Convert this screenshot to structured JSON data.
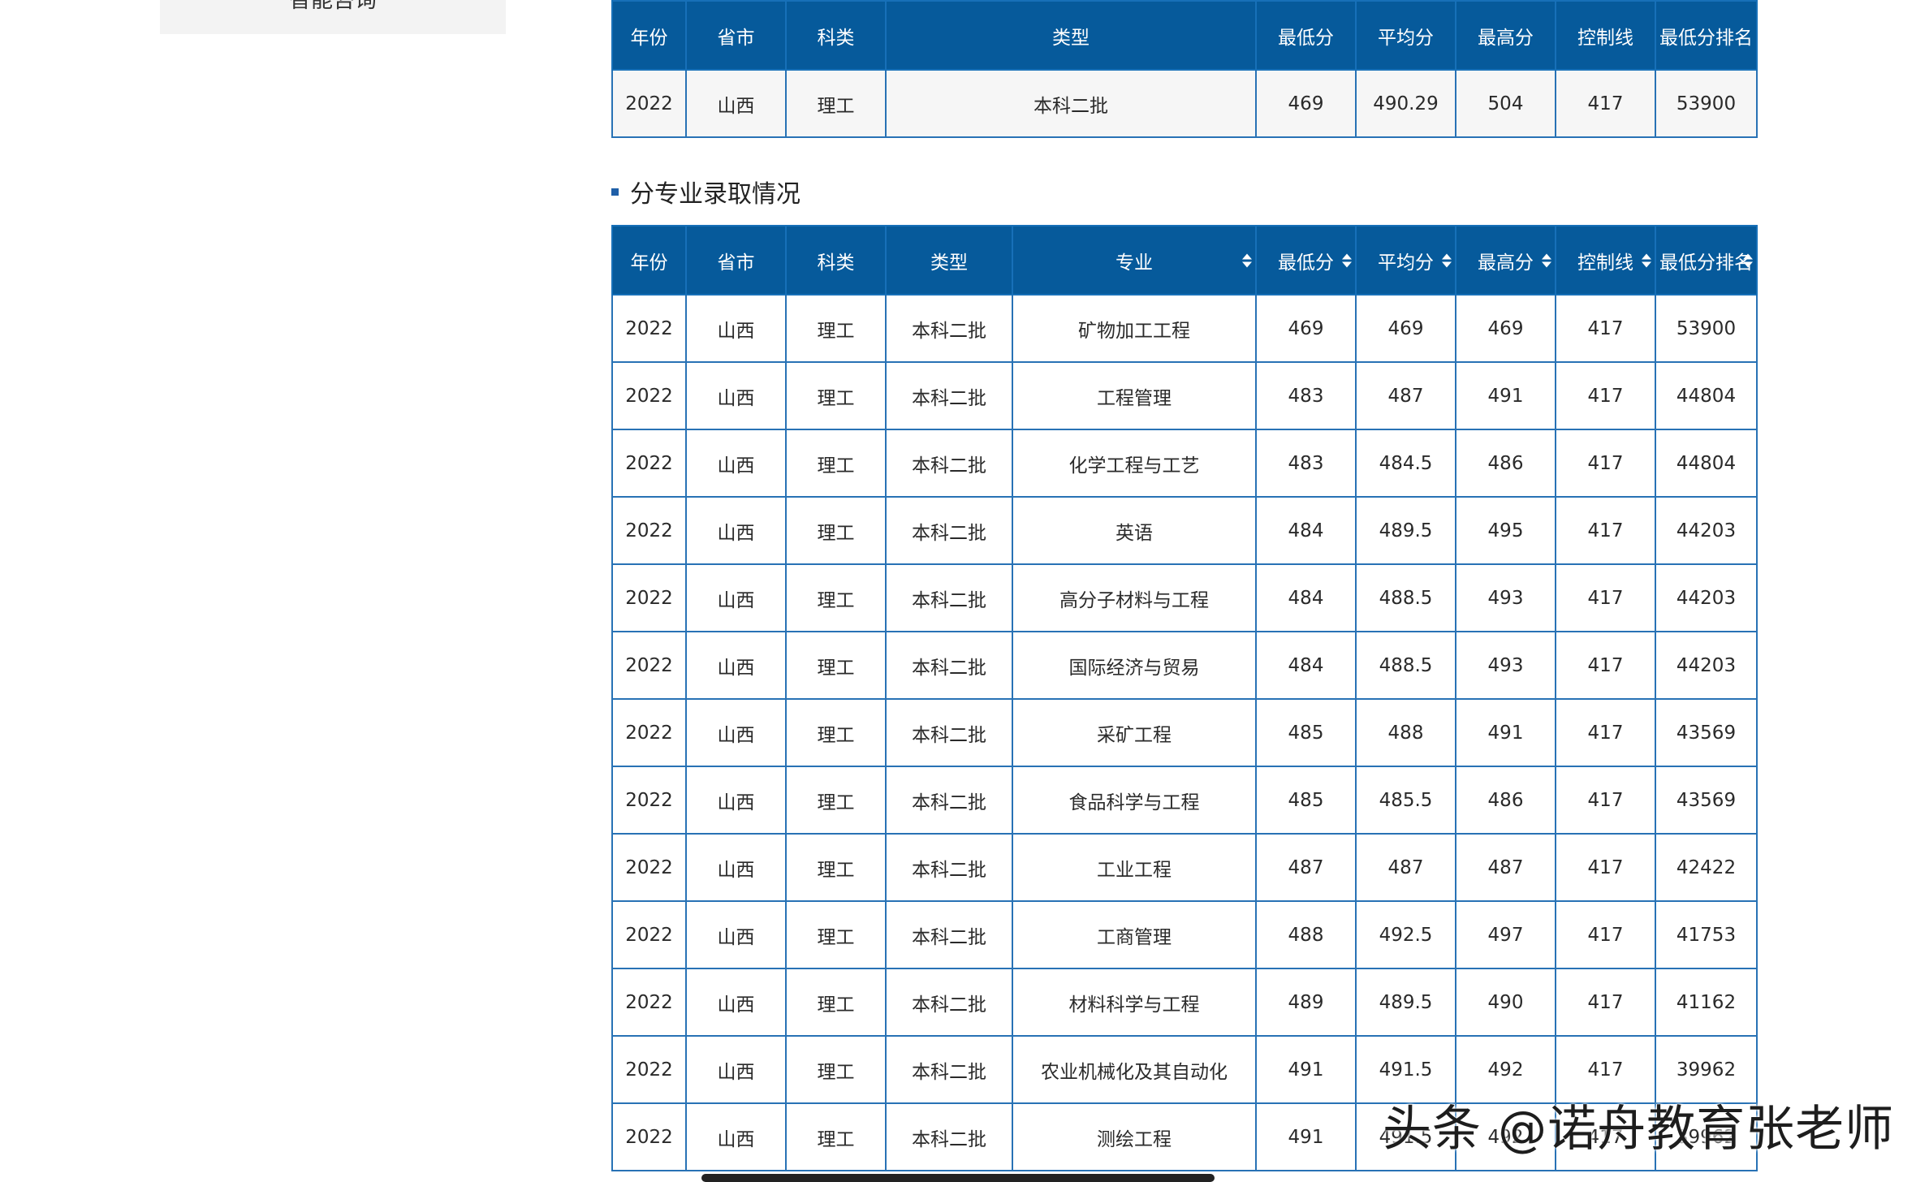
{
  "sidebar": {
    "partial_label": "智能咨询"
  },
  "summary_table": {
    "headers": [
      "年份",
      "省市",
      "科类",
      "类型",
      "最低分",
      "平均分",
      "最高分",
      "控制线",
      "最低分排名"
    ],
    "rows": [
      [
        "2022",
        "山西",
        "理工",
        "本科二批",
        "469",
        "490.29",
        "504",
        "417",
        "53900"
      ]
    ]
  },
  "section_title": "分专业录取情况",
  "major_table": {
    "headers": [
      "年份",
      "省市",
      "科类",
      "类型",
      "专业",
      "最低分",
      "平均分",
      "最高分",
      "控制线",
      "最低分排名"
    ],
    "rows": [
      [
        "2022",
        "山西",
        "理工",
        "本科二批",
        "矿物加工工程",
        "469",
        "469",
        "469",
        "417",
        "53900"
      ],
      [
        "2022",
        "山西",
        "理工",
        "本科二批",
        "工程管理",
        "483",
        "487",
        "491",
        "417",
        "44804"
      ],
      [
        "2022",
        "山西",
        "理工",
        "本科二批",
        "化学工程与工艺",
        "483",
        "484.5",
        "486",
        "417",
        "44804"
      ],
      [
        "2022",
        "山西",
        "理工",
        "本科二批",
        "英语",
        "484",
        "489.5",
        "495",
        "417",
        "44203"
      ],
      [
        "2022",
        "山西",
        "理工",
        "本科二批",
        "高分子材料与工程",
        "484",
        "488.5",
        "493",
        "417",
        "44203"
      ],
      [
        "2022",
        "山西",
        "理工",
        "本科二批",
        "国际经济与贸易",
        "484",
        "488.5",
        "493",
        "417",
        "44203"
      ],
      [
        "2022",
        "山西",
        "理工",
        "本科二批",
        "采矿工程",
        "485",
        "488",
        "491",
        "417",
        "43569"
      ],
      [
        "2022",
        "山西",
        "理工",
        "本科二批",
        "食品科学与工程",
        "485",
        "485.5",
        "486",
        "417",
        "43569"
      ],
      [
        "2022",
        "山西",
        "理工",
        "本科二批",
        "工业工程",
        "487",
        "487",
        "487",
        "417",
        "42422"
      ],
      [
        "2022",
        "山西",
        "理工",
        "本科二批",
        "工商管理",
        "488",
        "492.5",
        "497",
        "417",
        "41753"
      ],
      [
        "2022",
        "山西",
        "理工",
        "本科二批",
        "材料科学与工程",
        "489",
        "489.5",
        "490",
        "417",
        "41162"
      ],
      [
        "2022",
        "山西",
        "理工",
        "本科二批",
        "农业机械化及其自动化",
        "491",
        "491.5",
        "492",
        "417",
        "39962"
      ],
      [
        "2022",
        "山西",
        "理工",
        "本科二批",
        "测绘工程",
        "491",
        "491.5",
        "492",
        "417",
        "39962"
      ]
    ]
  },
  "watermark": "头条 @诺舟教育张老师",
  "colors": {
    "header_bg": "#065a9b",
    "border": "#2872b5",
    "summary_row_bg": "#f6f6f6",
    "sidebar_bg": "#f3f3f3"
  }
}
